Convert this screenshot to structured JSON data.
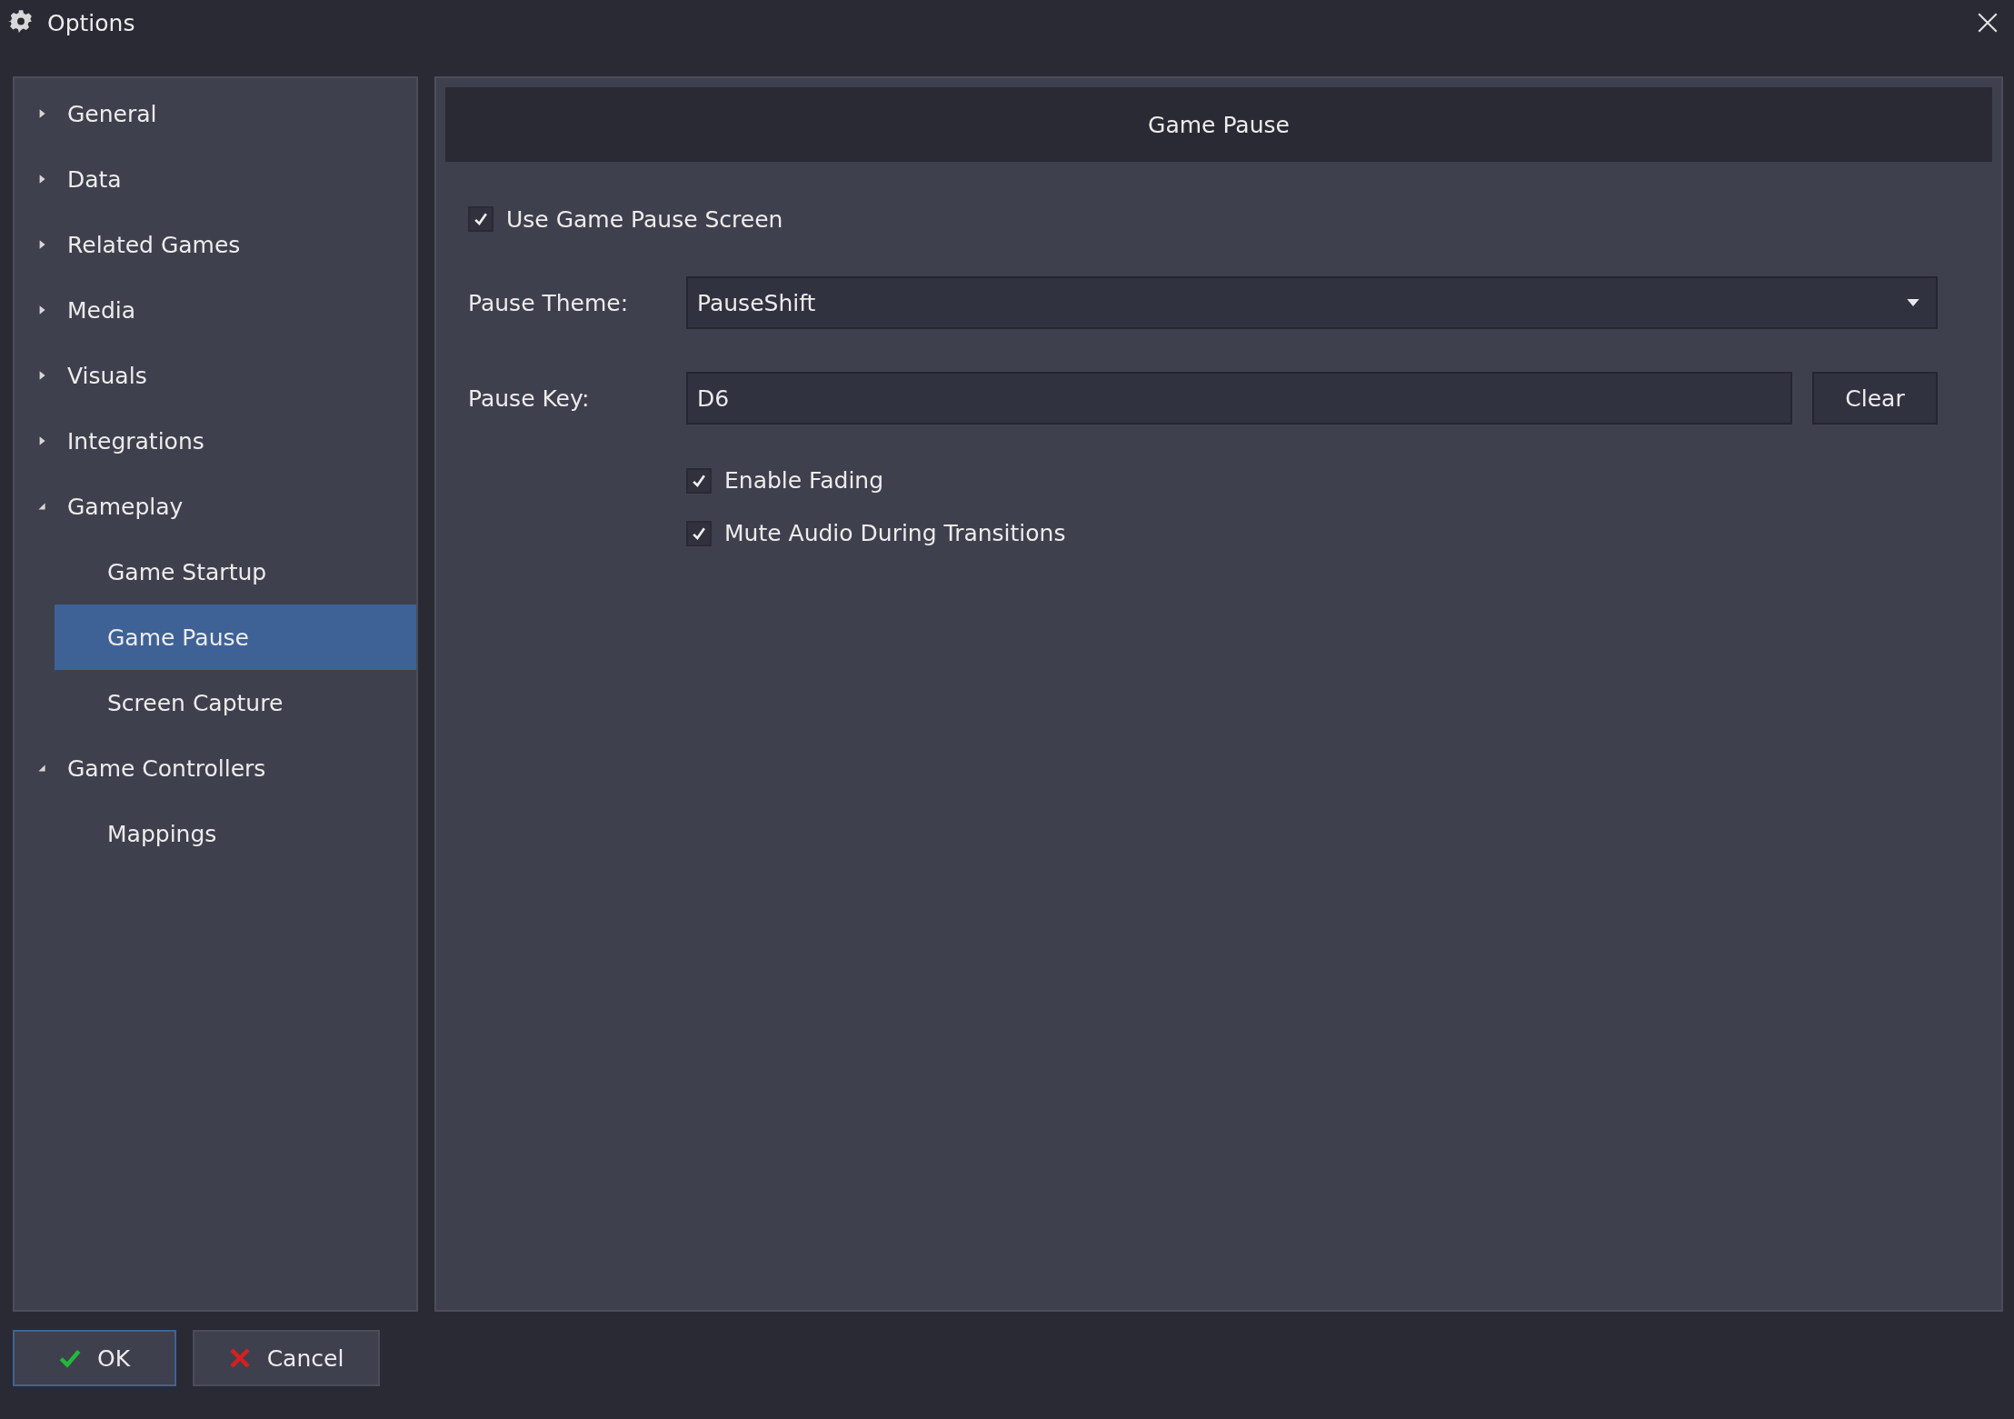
{
  "window": {
    "title": "Options"
  },
  "sidebar": {
    "items": [
      {
        "label": "General",
        "expanded": false,
        "selected": false
      },
      {
        "label": "Data",
        "expanded": false,
        "selected": false
      },
      {
        "label": "Related Games",
        "expanded": false,
        "selected": false
      },
      {
        "label": "Media",
        "expanded": false,
        "selected": false
      },
      {
        "label": "Visuals",
        "expanded": false,
        "selected": false
      },
      {
        "label": "Integrations",
        "expanded": false,
        "selected": false
      },
      {
        "label": "Gameplay",
        "expanded": true,
        "selected": false,
        "children": [
          {
            "label": "Game Startup",
            "selected": false
          },
          {
            "label": "Game Pause",
            "selected": true
          },
          {
            "label": "Screen Capture",
            "selected": false
          }
        ]
      },
      {
        "label": "Game Controllers",
        "expanded": true,
        "selected": false,
        "children": [
          {
            "label": "Mappings",
            "selected": false
          }
        ]
      }
    ]
  },
  "panel": {
    "title": "Game Pause",
    "use_pause_screen": {
      "label": "Use Game Pause Screen",
      "checked": true
    },
    "theme": {
      "label": "Pause Theme:",
      "value": "PauseShift"
    },
    "key": {
      "label": "Pause Key:",
      "value": "D6",
      "button": "Clear"
    },
    "options": [
      {
        "label": "Enable Fading",
        "checked": true
      },
      {
        "label": "Mute Audio During Transitions",
        "checked": true
      }
    ]
  },
  "buttons": [
    {
      "kind": "ok",
      "label": "OK"
    },
    {
      "kind": "cancel",
      "label": "Cancel"
    }
  ]
}
